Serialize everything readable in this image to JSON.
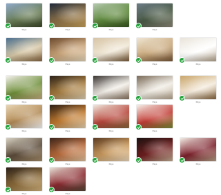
{
  "gallery": {
    "items": [
      {
        "caption": "Pays",
        "photo": "landscape-village",
        "colors": [
          "#8fa9c9",
          "#6a7e57",
          "#3f4a2a"
        ],
        "selected": true
      },
      {
        "caption": "Pays",
        "photo": "hotel-facade-night",
        "colors": [
          "#1f2a3a",
          "#8b7047",
          "#c9a35c"
        ],
        "selected": true
      },
      {
        "caption": "Pays",
        "photo": "vineyard-rows",
        "colors": [
          "#b6c9b0",
          "#5f8a3d",
          "#3b5a22"
        ],
        "selected": true
      },
      {
        "caption": "Pays",
        "photo": "river-town-aerial",
        "colors": [
          "#6c7c86",
          "#4a5a45",
          "#8e8a7a"
        ],
        "selected": true
      },
      {
        "caption": "Pays",
        "photo": "bedroom-blue",
        "colors": [
          "#4a6f8f",
          "#d8c9a8",
          "#8a6a45"
        ],
        "selected": true
      },
      {
        "caption": "Pays",
        "photo": "bedroom-warm",
        "colors": [
          "#6b4a2f",
          "#caa57a",
          "#e8d9be"
        ],
        "selected": true
      },
      {
        "caption": "Pays",
        "photo": "bedroom-beams",
        "colors": [
          "#d6c4a6",
          "#f1e8d7",
          "#7c5c3a"
        ],
        "selected": true
      },
      {
        "caption": "Pays",
        "photo": "bedroom-attic",
        "colors": [
          "#efe6d4",
          "#c9a87c",
          "#7a5a3a"
        ],
        "selected": true
      },
      {
        "caption": "Pays",
        "photo": "bathroom-white",
        "colors": [
          "#e9e4da",
          "#ffffff",
          "#b9a890"
        ],
        "selected": true
      },
      {
        "caption": "Pays",
        "photo": "dish-plated",
        "colors": [
          "#f3f1ec",
          "#6f8f3a",
          "#c7b184"
        ],
        "selected": true
      },
      {
        "caption": "Pays",
        "photo": "dish-dark",
        "colors": [
          "#2b2219",
          "#a67c3f",
          "#e1d2b6"
        ],
        "selected": true
      },
      {
        "caption": "Pays",
        "photo": "chef-portrait",
        "colors": [
          "#3a3431",
          "#f1ede6",
          "#8a7561"
        ],
        "selected": true
      },
      {
        "caption": "Pays",
        "photo": "two-chefs",
        "colors": [
          "#7a6a58",
          "#f0ece4",
          "#b8a891"
        ],
        "selected": true
      },
      {
        "caption": "Pays",
        "photo": "restaurant-room",
        "colors": [
          "#c9a66b",
          "#f4eadb",
          "#8a6840"
        ],
        "selected": true
      },
      {
        "caption": "Pays",
        "photo": "dining-table",
        "colors": [
          "#e8d6b6",
          "#b28a55",
          "#ffffff"
        ],
        "selected": true
      },
      {
        "caption": "Pays",
        "photo": "glasses-fireplace",
        "colors": [
          "#2a1d14",
          "#c07a2f",
          "#e9d7b8"
        ],
        "selected": true
      },
      {
        "caption": "Pays",
        "photo": "dessert-plate",
        "colors": [
          "#efe9df",
          "#b8473c",
          "#8b6a3f"
        ],
        "selected": true
      },
      {
        "caption": "Pays",
        "photo": "red-dish",
        "colors": [
          "#f5f1ea",
          "#c23d36",
          "#7a8f3a"
        ],
        "selected": true
      },
      {
        "caption": "Pays",
        "photo": "lounge-windows",
        "colors": [
          "#d8d2c4",
          "#5b4b3a",
          "#a88f6c"
        ],
        "selected": true
      },
      {
        "caption": "Pays",
        "photo": "wine-cellar-bottles",
        "colors": [
          "#3a241a",
          "#b86a3a",
          "#e3c7a4"
        ],
        "selected": true
      },
      {
        "caption": "Pays",
        "photo": "cellar-barrels",
        "colors": [
          "#5a3a22",
          "#c99a5e",
          "#f0dcc0"
        ],
        "selected": true
      },
      {
        "caption": "Pays",
        "photo": "wine-bottles-rack",
        "colors": [
          "#1a1210",
          "#6e1f1f",
          "#c9b49a"
        ],
        "selected": true
      },
      {
        "caption": "Pays",
        "photo": "wine-glasses-table",
        "colors": [
          "#f2ede6",
          "#7b1f2a",
          "#b8a48a"
        ],
        "selected": true
      },
      {
        "caption": "Pays",
        "photo": "bar-bottles",
        "colors": [
          "#2a2018",
          "#8a6a3a",
          "#d6b680"
        ],
        "selected": true
      },
      {
        "caption": "Pays",
        "photo": "wine-glass-pour",
        "colors": [
          "#e8e2d8",
          "#8a2a30",
          "#5a4a3a"
        ],
        "selected": true
      }
    ]
  }
}
